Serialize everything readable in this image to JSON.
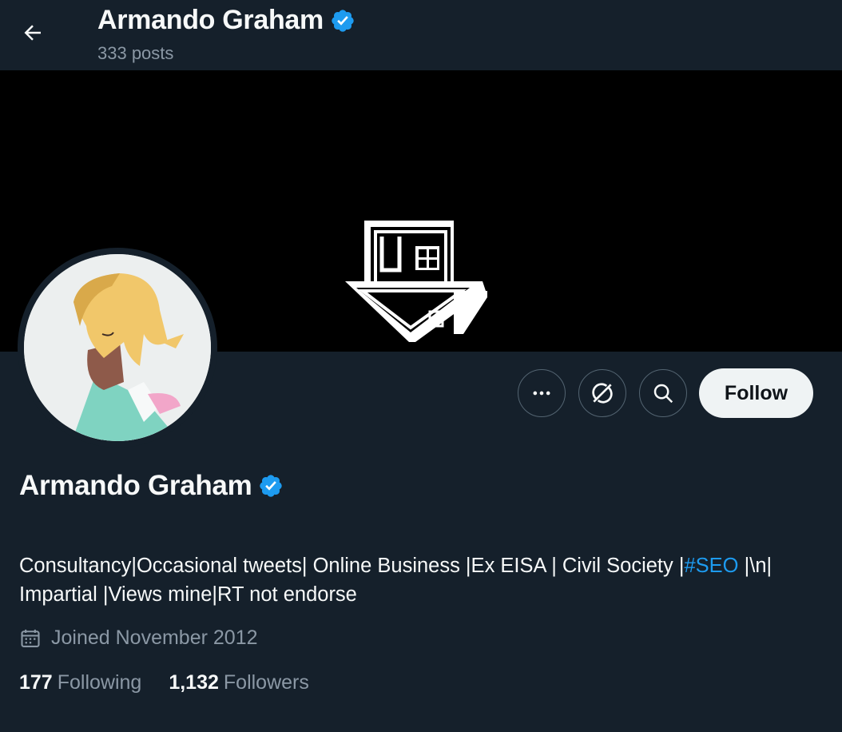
{
  "header": {
    "display_name": "Armando Graham",
    "post_count": "333 posts"
  },
  "icons": {
    "back": "arrow-left-icon",
    "verified": "verified-badge-icon",
    "more": "ellipsis-icon",
    "grok": "grok-icon",
    "search": "search-icon",
    "calendar": "calendar-icon"
  },
  "actions": {
    "follow_label": "Follow"
  },
  "profile": {
    "display_name": "Armando Graham",
    "bio_part1": "Consultancy|Occasional tweets| Online Business |Ex EISA | Civil Society |",
    "bio_hashtag": "#SEO",
    "bio_part2": " |\\n|",
    "bio_line2": "Impartial |Views mine|RT not endorse",
    "joined": "Joined November 2012",
    "following_count": "177",
    "following_label": "Following",
    "followers_count": "1,132",
    "followers_label": "Followers"
  },
  "colors": {
    "background": "#15202b",
    "accent": "#1d9bf0",
    "muted_text": "#8b98a5",
    "follow_button": "#eff3f4"
  }
}
